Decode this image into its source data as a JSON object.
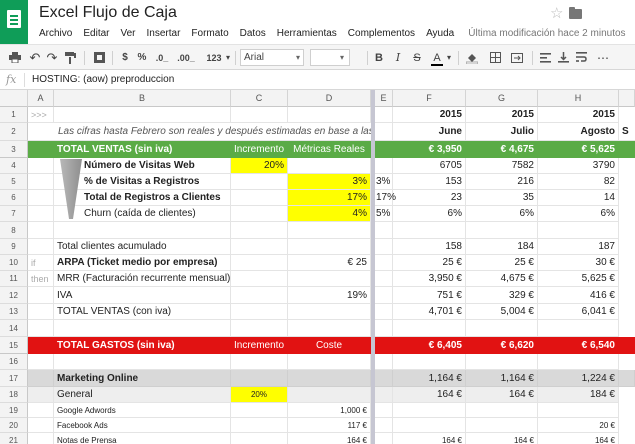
{
  "app": {
    "title": "Excel Flujo de Caja",
    "menus": [
      "Archivo",
      "Editar",
      "Ver",
      "Insertar",
      "Formato",
      "Datos",
      "Herramientas",
      "Complementos",
      "Ayuda"
    ],
    "last_edit": "Última modificación hace 2 minutos"
  },
  "toolbar": {
    "currency": "$",
    "percent": "%",
    "dec_less": ".0_",
    "dec_more": ".00_",
    "number_format": "123",
    "font": "Arial",
    "bold": "B",
    "italic": "I",
    "strike": "S",
    "text_color": "A"
  },
  "formula_bar": {
    "fx": "fx",
    "content": "HOSTING: (aow) preproduccion"
  },
  "columns": [
    "A",
    "B",
    "C",
    "D",
    "E",
    "F",
    "G",
    "H"
  ],
  "rows": {
    "r1": {
      "num": "1",
      "a": ">>>",
      "f": "2015",
      "g": "2015",
      "h": "2015",
      "i": ""
    },
    "r2": {
      "num": "2",
      "b": "Las cifras hasta Febrero  son reales y después estimadas en base a las métricas",
      "f": "June",
      "g": "Julio",
      "h": "Agosto",
      "i": "S"
    },
    "r3": {
      "num": "3",
      "b": "TOTAL VENTAS (sin iva)",
      "c": "Incremento",
      "d": "Métricas Reales",
      "f": "€ 3,950",
      "g": "€ 4,675",
      "h": "€ 5,625"
    },
    "r4": {
      "num": "4",
      "b": "Número de Visitas Web",
      "c": "20%",
      "f": "6705",
      "g": "7582",
      "h": "3790"
    },
    "r5": {
      "num": "5",
      "b": "% de Visitas a Registros",
      "d": "3%",
      "e": "3%",
      "f": "153",
      "g": "216",
      "h": "82"
    },
    "r6": {
      "num": "6",
      "b": "Total de Registros a Clientes",
      "d": "17%",
      "e": "17%",
      "f": "23",
      "g": "35",
      "h": "14"
    },
    "r7": {
      "num": "7",
      "b": "Churn (caída de clientes)",
      "d": "4%",
      "e": "5%",
      "f": "6%",
      "g": "6%",
      "h": "6%"
    },
    "r8": {
      "num": "8"
    },
    "r9": {
      "num": "9",
      "b": "Total clientes acumulado",
      "f": "158",
      "g": "184",
      "h": "187"
    },
    "r10": {
      "num": "10",
      "a": "if",
      "b": "ARPA (Ticket medio por empresa)",
      "d": "€ 25",
      "f": "25 €",
      "g": "25 €",
      "h": "30 €"
    },
    "r11": {
      "num": "11",
      "a": "then",
      "b": "MRR (Facturación recurrente mensual)",
      "f": "3,950 €",
      "g": "4,675 €",
      "h": "5,625 €"
    },
    "r12": {
      "num": "12",
      "b": "IVA",
      "d": "19%",
      "f": "751 €",
      "g": "329 €",
      "h": "416 €"
    },
    "r13": {
      "num": "13",
      "b": "TOTAL VENTAS (con iva)",
      "f": "4,701 €",
      "g": "5,004 €",
      "h": "6,041 €"
    },
    "r14": {
      "num": "14"
    },
    "r15": {
      "num": "15",
      "b": "TOTAL GASTOS (sin iva)",
      "c": "Incremento",
      "d": "Coste",
      "f": "€ 6,405",
      "g": "€ 6,620",
      "h": "€ 6,540"
    },
    "r16": {
      "num": "16"
    },
    "r17": {
      "num": "17",
      "b": "Marketing Online",
      "f": "1,164 €",
      "g": "1,164 €",
      "h": "1,224 €"
    },
    "r18": {
      "num": "18",
      "b": "General",
      "c": "20%",
      "f": "164 €",
      "g": "164 €",
      "h": "184 €"
    },
    "r19": {
      "num": "19",
      "b": "Google Adwords",
      "d": "1,000 €"
    },
    "r20": {
      "num": "20",
      "b": "Facebook Ads",
      "d": "117 €",
      "h": "20 €"
    },
    "r21": {
      "num": "21",
      "b": "Notas de Prensa",
      "d": "164 €",
      "f": "164 €",
      "g": "164 €",
      "h": "164 €"
    }
  },
  "colors": {
    "green": "#5aab46",
    "red": "#e11212",
    "yellow": "#ffff00",
    "sheets_green": "#0f9d58"
  }
}
